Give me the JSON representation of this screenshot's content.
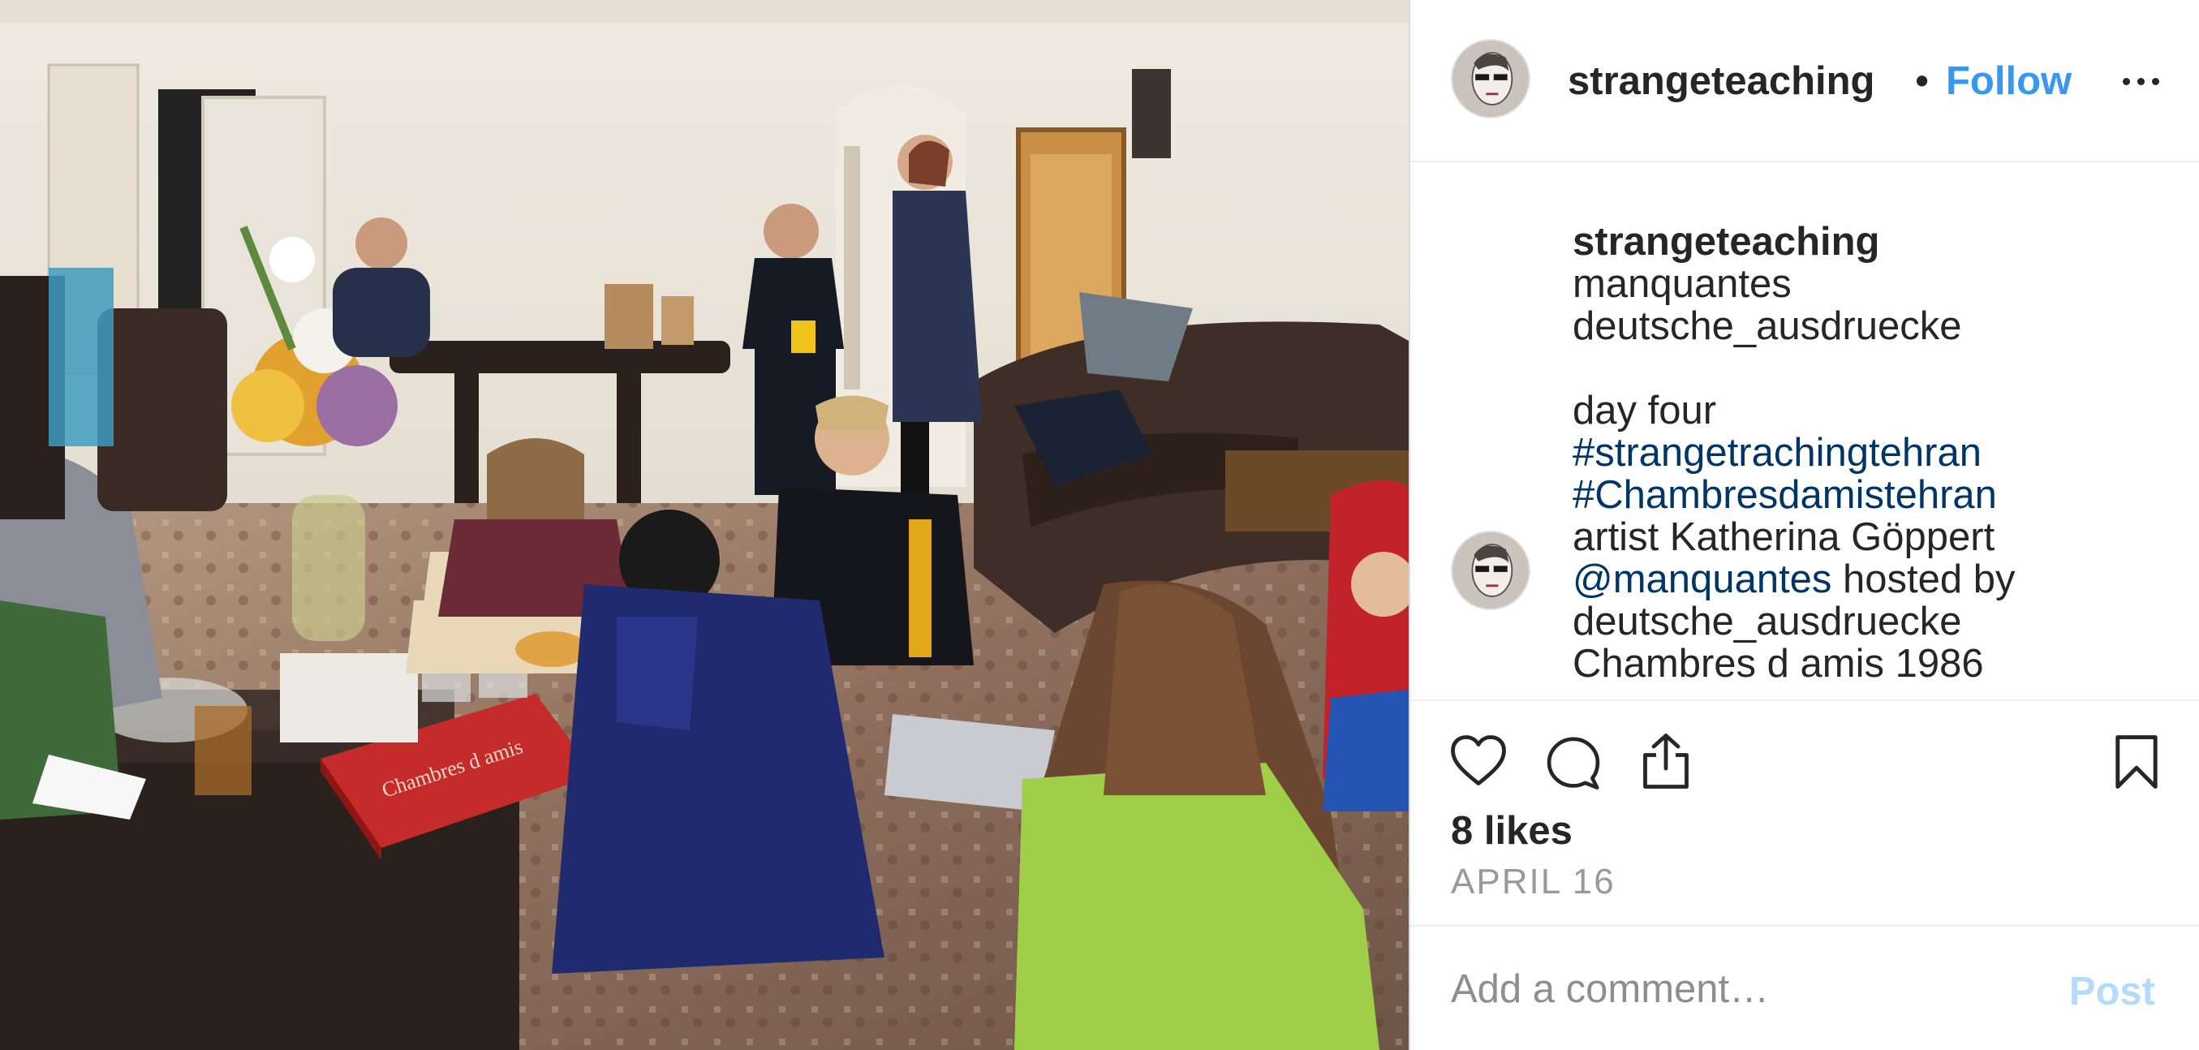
{
  "post": {
    "username": "strangeteaching",
    "separator": "•",
    "follow_label": "Follow",
    "more_icon": "more-options-icon",
    "caption": {
      "owner": "strangeteaching",
      "lines": [
        "manquantes",
        "deutsche_ausdruecke",
        "",
        "day four"
      ],
      "hashtag_1": "#strangetrachingtehran",
      "hashtag_2": "#Chambresdamistehran",
      "line_artist": "artist Katherina Göppert",
      "mention": "@manquantes",
      "mention_suffix": " hosted by",
      "line_host": "deutsche_ausdruecke",
      "line_project": "Chambres d amis 1986"
    },
    "actions": {
      "like_icon": "heart-icon",
      "comment_icon": "comment-icon",
      "share_icon": "share-icon",
      "save_icon": "bookmark-icon"
    },
    "likes": "8 likes",
    "date": "APRIL 16",
    "comment": {
      "placeholder": "Add a comment…",
      "post_label": "Post"
    }
  },
  "photo_book_spine": "Chambres d amis"
}
